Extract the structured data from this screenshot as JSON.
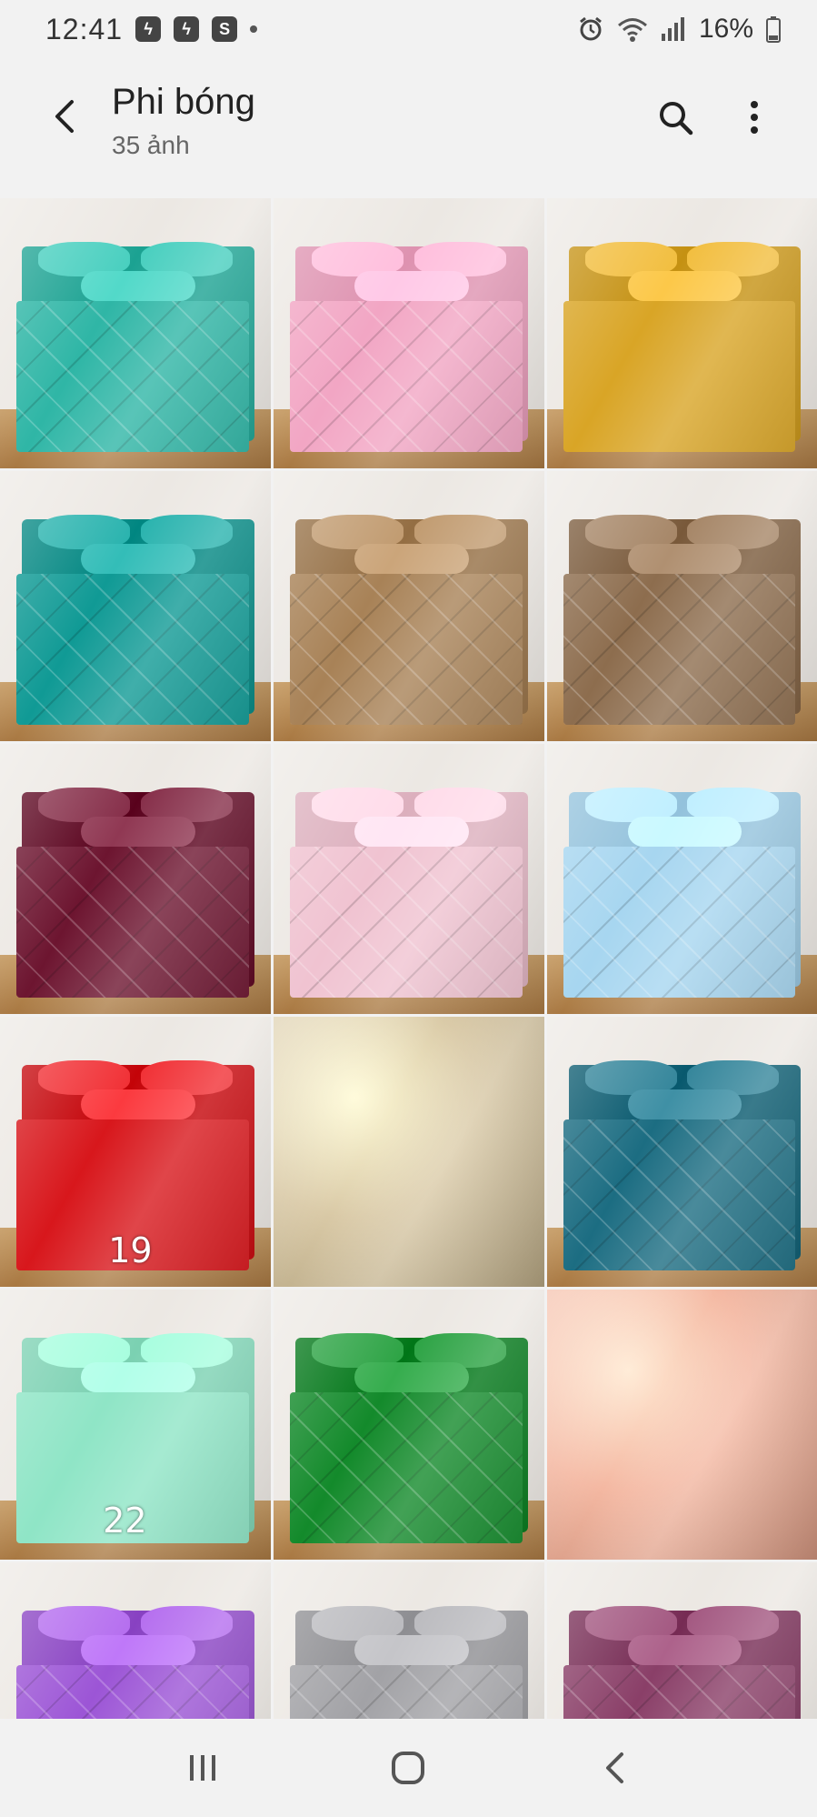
{
  "status_bar": {
    "time": "12:41",
    "battery": "16%",
    "notification_icons": [
      "messenger-icon",
      "messenger-icon",
      "shop-icon"
    ]
  },
  "header": {
    "title": "Phi bóng",
    "subtitle": "35 ảnh"
  },
  "grid": {
    "tiles": [
      {
        "id": "p1",
        "color": "#2fb6a6",
        "label": ""
      },
      {
        "id": "p2",
        "color": "#f2a6c4",
        "label": ""
      },
      {
        "id": "p3",
        "color": "#d9a526",
        "label": ""
      },
      {
        "id": "p4",
        "color": "#109a95",
        "label": ""
      },
      {
        "id": "p5",
        "color": "#a88257",
        "label": ""
      },
      {
        "id": "p6",
        "color": "#8d6d4e",
        "label": ""
      },
      {
        "id": "p7",
        "color": "#6d1530",
        "label": ""
      },
      {
        "id": "p8",
        "color": "#f0c3d1",
        "label": ""
      },
      {
        "id": "p9",
        "color": "#a7d6f0",
        "label": ""
      },
      {
        "id": "p10",
        "color": "#d8171c",
        "label": "19"
      },
      {
        "id": "p11",
        "color": "#d9c9a6",
        "label": ""
      },
      {
        "id": "p12",
        "color": "#1c6d82",
        "label": ""
      },
      {
        "id": "p13",
        "color": "#8fe5c6",
        "label": "22"
      },
      {
        "id": "p14",
        "color": "#138a2b",
        "label": ""
      },
      {
        "id": "p15",
        "color": "#f4b8a2",
        "label": ""
      },
      {
        "id": "p16",
        "color": "#9c55d6",
        "label": ""
      },
      {
        "id": "p17",
        "color": "#a2a2a6",
        "label": ""
      },
      {
        "id": "p18",
        "color": "#8a3f68",
        "label": ""
      }
    ]
  },
  "colors": {
    "background": "#f2f2f2",
    "text_primary": "#222222",
    "text_secondary": "#666666"
  }
}
